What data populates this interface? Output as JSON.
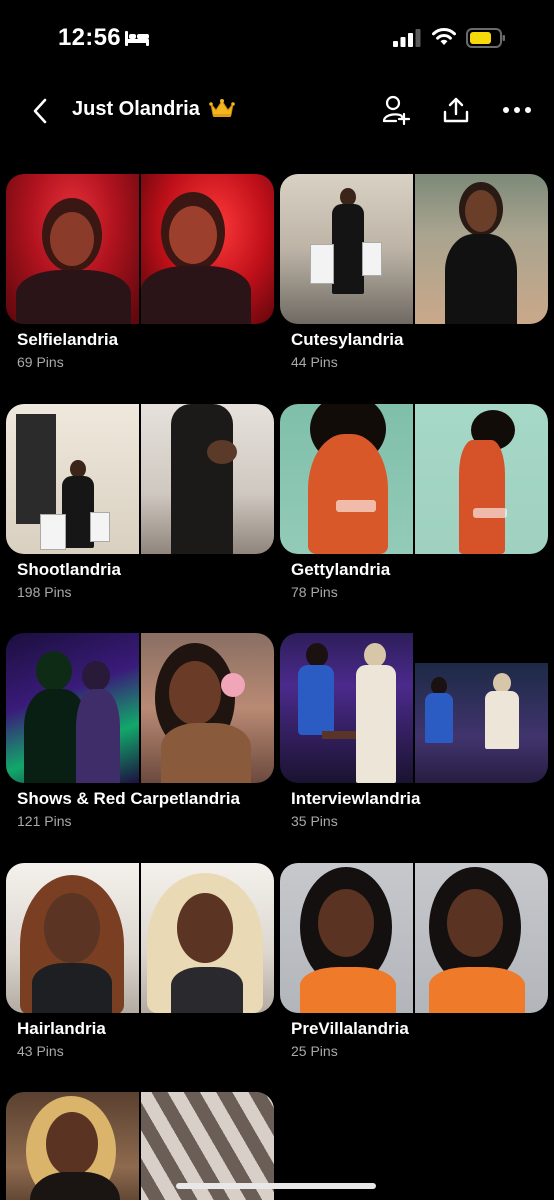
{
  "status_bar": {
    "time": "12:56"
  },
  "header": {
    "title": "Just Olandria"
  },
  "boards": [
    {
      "name": "Selfielandria",
      "count": "69 Pins"
    },
    {
      "name": "Cutesylandria",
      "count": "44 Pins"
    },
    {
      "name": "Shootlandria",
      "count": "198 Pins"
    },
    {
      "name": "Gettylandria",
      "count": "78 Pins"
    },
    {
      "name": "Shows & Red Carpetlandria",
      "count": "121 Pins"
    },
    {
      "name": "Interviewlandria",
      "count": "35 Pins"
    },
    {
      "name": "Hairlandria",
      "count": "43 Pins"
    },
    {
      "name": "PreVillalandria",
      "count": "25 Pins"
    },
    {
      "name": "",
      "count": ""
    }
  ],
  "colors": {
    "background": "#000000",
    "text_primary": "#ffffff",
    "text_secondary": "#a9a9a9",
    "battery": "#f5d90a"
  },
  "icons": [
    "bed-icon",
    "cellular-signal-icon",
    "wifi-icon",
    "battery-icon",
    "back-chevron-icon",
    "crown-icon",
    "add-collaborator-icon",
    "share-icon",
    "more-options-icon"
  ]
}
